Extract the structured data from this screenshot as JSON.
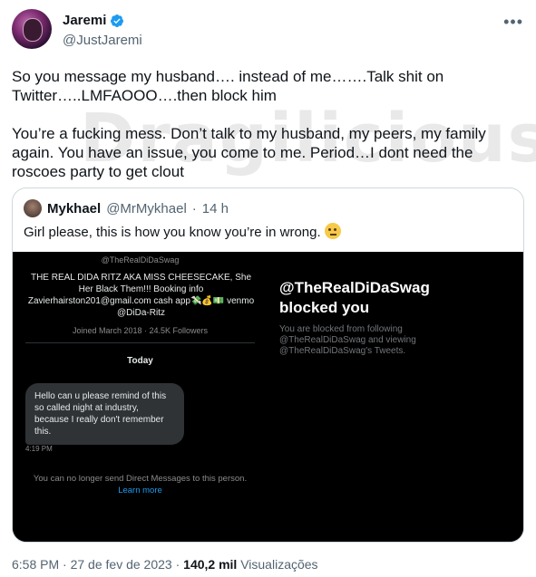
{
  "author": {
    "name": "Jaremi",
    "handle": "@JustJaremi"
  },
  "tweet": {
    "paragraph1": "So you message my husband…. instead of me…….Talk shit on Twitter…..LMFAOOO….then block him",
    "paragraph2": "You’re a fucking mess. Don’t talk to my husband, my peers, my family again. You have an issue, you come to me. Period…I dont need the roscoes party to get clout"
  },
  "watermark": "Dragilicious",
  "quote": {
    "name": "Mykhael",
    "handle": "@MrMykhael",
    "separator": "·",
    "time": "14 h",
    "text": "Girl please, this is how you know you’re in wrong.",
    "left_panel": {
      "top_handle": "@TheRealDiDaSwag",
      "bio": "THE REAL DIDA RITZ AKA MISS CHEESECAKE, She Her Black Them!!! Booking info Zavierhairston201@gmail.com cash app💸💰💵 venmo @DiDa-Ritz",
      "joined": "Joined March 2018 · 24.5K Followers",
      "today": "Today",
      "message": "Hello can u please remind of this so called night at industry, because I really don't remember this.",
      "message_time": "4:19 PM",
      "no_more": "You can no longer send Direct Messages to this person.",
      "learn_more": "Learn more"
    },
    "right_panel": {
      "handle": "@TheRealDiDaSwag",
      "title": "blocked you",
      "desc": "You are blocked from following @TheRealDiDaSwag and viewing @TheRealDiDaSwag's Tweets."
    }
  },
  "footer": {
    "time": "6:58 PM",
    "date": "27 de fev de 2023",
    "views_count": "140,2 mil",
    "views_label": "Visualizações",
    "dot": "·"
  },
  "colors": {
    "verified": "#1d9bf0",
    "link": "#1d9bf0",
    "secondary_text": "#536471"
  }
}
